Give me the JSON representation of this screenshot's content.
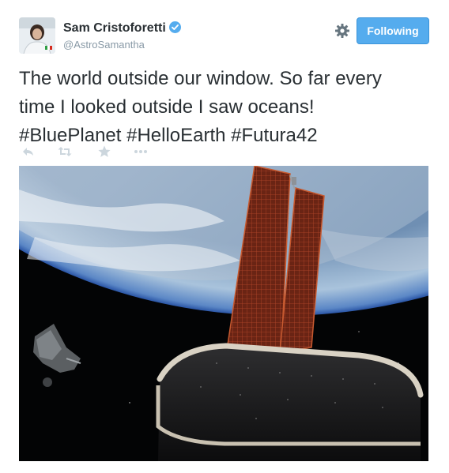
{
  "user": {
    "fullname": "Sam Cristoforetti",
    "username": "@AstroSamantha",
    "verified": true
  },
  "controls": {
    "follow_label": "Following",
    "accent_color": "#55acee"
  },
  "tweet": {
    "lines": [
      "The world outside our window. So  far every",
      "time I looked outside I saw oceans!",
      "#BluePlanet #HelloEarth #Futura42"
    ]
  },
  "actions": [
    {
      "name": "reply",
      "icon": "reply-icon"
    },
    {
      "name": "retweet",
      "icon": "retweet-icon"
    },
    {
      "name": "favorite",
      "icon": "star-icon"
    },
    {
      "name": "more",
      "icon": "more-icon"
    }
  ],
  "media": {
    "type": "photo"
  }
}
